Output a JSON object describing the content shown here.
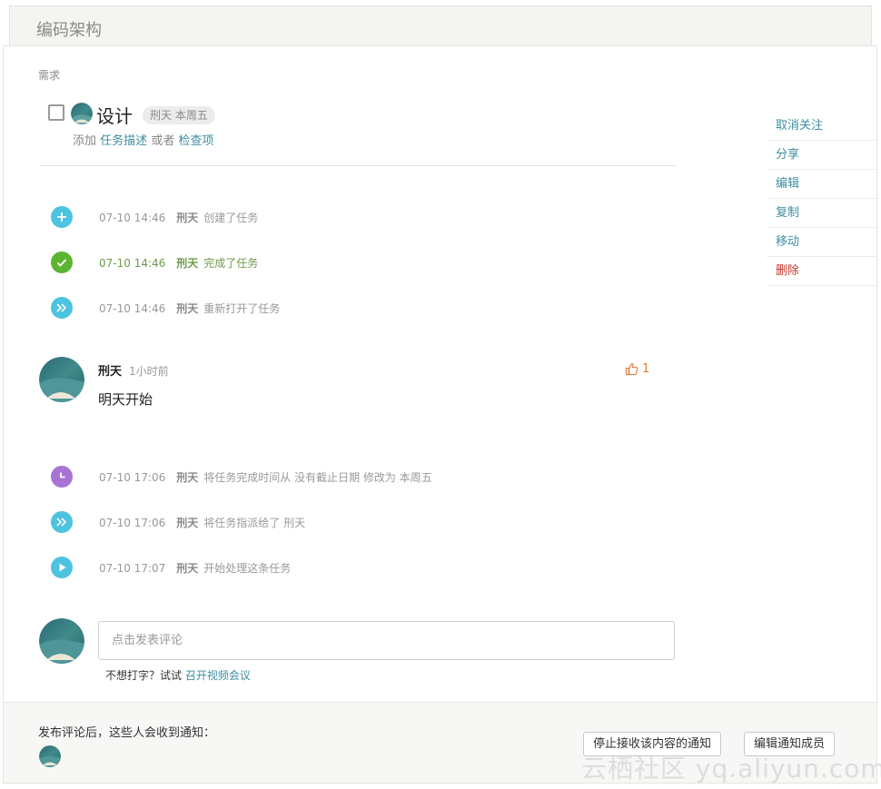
{
  "project": {
    "title": "编码架构"
  },
  "task": {
    "section_label": "需求",
    "title": "设计",
    "tag": "刑天 本周五",
    "sub_prefix": "添加",
    "sub_link1": "任务描述",
    "sub_middle": "或者",
    "sub_link2": "检查项"
  },
  "actions": [
    {
      "label": "取消关注"
    },
    {
      "label": "分享"
    },
    {
      "label": "编辑"
    },
    {
      "label": "复制"
    },
    {
      "label": "移动"
    },
    {
      "label": "删除"
    }
  ],
  "events_top": [
    {
      "time": "07-10 14:46",
      "user": "刑天",
      "text": "创建了任务",
      "icon": "plus-icon",
      "color": "#4cc3e0"
    },
    {
      "time": "07-10 14:46",
      "user": "刑天",
      "text": "完成了任务",
      "icon": "check-icon",
      "color": "#5cb531"
    },
    {
      "time": "07-10 14:46",
      "user": "刑天",
      "text": "重新打开了任务",
      "icon": "double-chevron-icon",
      "color": "#4cc3e0"
    }
  ],
  "comment": {
    "author": "刑天",
    "time": "1小时前",
    "body": "明天开始",
    "likes": "1"
  },
  "events_bottom": [
    {
      "time": "07-10 17:06",
      "user": "刑天",
      "text": "将任务完成时间从 没有截止日期 修改为 本周五",
      "icon": "clock-icon",
      "color": "#a973d3"
    },
    {
      "time": "07-10 17:06",
      "user": "刑天",
      "text": "将任务指派给了 刑天",
      "icon": "double-chevron-icon",
      "color": "#4cc3e0"
    },
    {
      "time": "07-10 17:07",
      "user": "刑天",
      "text": "开始处理这条任务",
      "icon": "play-icon",
      "color": "#4cc3e0"
    }
  ],
  "composer": {
    "placeholder": "点击发表评论",
    "hint_prefix": "不想打字？试试",
    "hint_link": "召开视频会议"
  },
  "footer": {
    "notify_label": "发布评论后，这些人会收到通知：",
    "stop_button": "停止接收该内容的通知",
    "edit_button": "编辑通知成员"
  },
  "watermark": "云栖社区 yq.aliyun.com",
  "colors": {
    "link": "#3e8ea0",
    "danger": "#c0392b",
    "like": "#e07b39"
  }
}
